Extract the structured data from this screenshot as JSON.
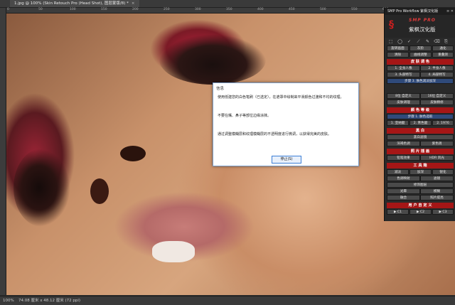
{
  "tab": {
    "title": "1.jpg @ 100% (Skin Retouch Pro (Head Shot), 图层蒙版/8) *",
    "close": "×"
  },
  "ruler_top": [
    "0",
    "50",
    "100",
    "150",
    "200",
    "250",
    "300",
    "350",
    "400",
    "450",
    "500",
    "550",
    "600"
  ],
  "status": {
    "zoom": "100%",
    "docinfo": "74.08 厘米 x 48.12 厘米 (72 ppi)"
  },
  "dialog": {
    "title": "信息",
    "lines": [
      "使用低建您的白色笔刷（已选定），在遮罩中绘制来平滑颜色过渡和不均的纹理。",
      "不要在嘴、鼻子等部位边缘涂抹。",
      "通过调整模糊层和纹理模糊层的不透明度进行微调，以获得完美的皮肤。"
    ],
    "ok_label": "停止(S)"
  },
  "panel": {
    "title": "SMP Pro Workflow 紫枫汉化版",
    "controls": "≡ ✕",
    "logo_mark": "§",
    "brand": "SMP PRO",
    "subtitle": "紫枫汉化版",
    "tools": [
      "⬚",
      "◯",
      "✓",
      "⟋",
      "✎",
      "⌫",
      "⎘"
    ],
    "row1": [
      "旋转画面",
      "灰阶",
      "通化"
    ],
    "row2": [
      "清除",
      "曲线调整",
      "重叠测"
    ],
    "section_skin": "皮 肤 调 色",
    "skin_rows": [
      [
        "1. 全身人像",
        "2. 半身人像"
      ],
      [
        "3. 头部特写",
        "4. 局部特写"
      ],
      [
        "步骤 3. 肤色减淡加深"
      ]
    ],
    "row_bit": [
      "8位 自定义",
      "16位 自定义"
    ],
    "row_skin2": [
      "皮肤调理",
      "皮肤精修"
    ],
    "section_color": "颜 色 等 级",
    "color_rows": [
      [
        "步骤 1. 肤色选取"
      ],
      [
        "1. 亚纳腿",
        "2. 青色腿",
        "2. 1976"
      ]
    ],
    "section_bw": "黑 白",
    "bw_rows": [
      [
        "黑白滤镜"
      ],
      [
        "深褐色调",
        "紫色调"
      ]
    ],
    "section_photo": "照 片 插 画",
    "photo_rows": [
      [
        "铅笔效果",
        "HDR 风光"
      ]
    ],
    "section_tool": "工 具 箱",
    "tool_rows": [
      [
        "减淡",
        "加深",
        "锐化"
      ],
      [
        "色调映射",
        "滤镜"
      ],
      [
        "修饰图层"
      ],
      [
        "光晕",
        "模糊"
      ],
      [
        "融合",
        "照片提亮"
      ]
    ],
    "section_user": "用 户 自 定 义",
    "user_row": [
      "▶ C1",
      "▶ C2",
      "▶ C3"
    ]
  }
}
